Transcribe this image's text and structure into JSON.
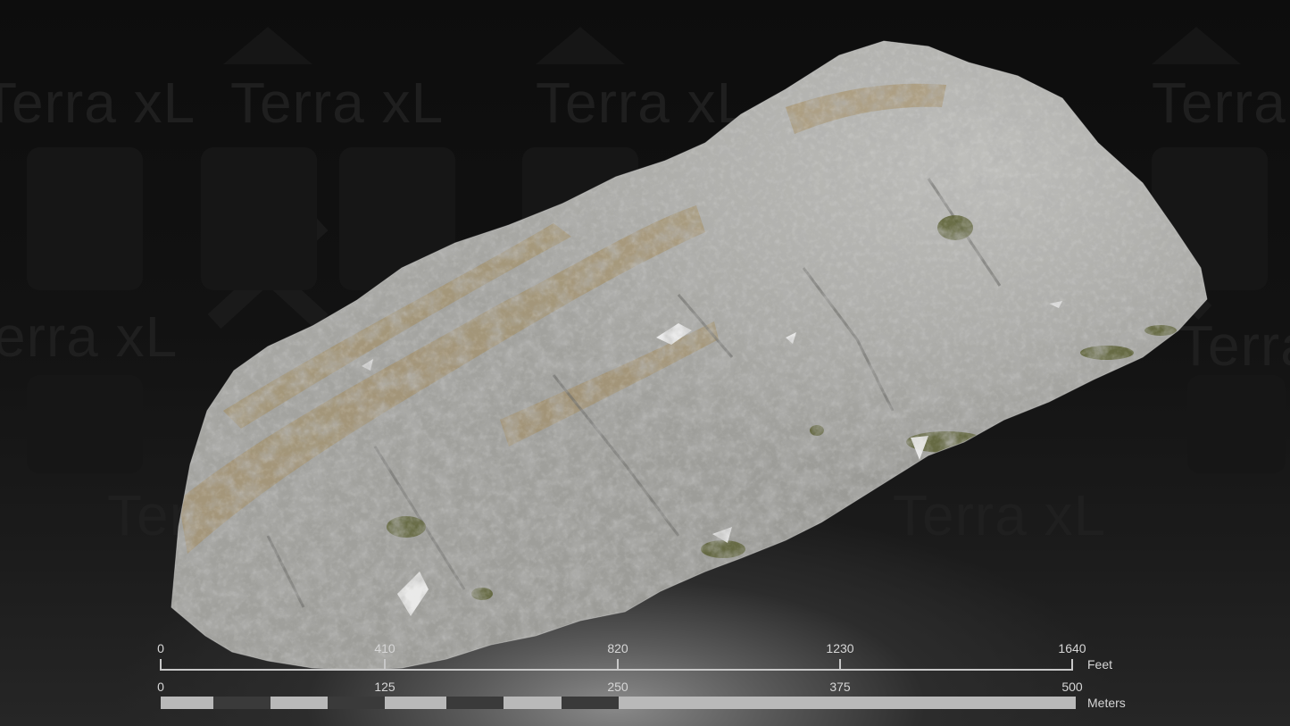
{
  "watermark": {
    "brand_text": "Terra xL"
  },
  "terrain": {
    "description_icon": "terrain-model-icon"
  },
  "scale_bar": {
    "feet": {
      "ticks": [
        "0",
        "410",
        "820",
        "1230",
        "1640"
      ],
      "unit": "Feet"
    },
    "meters": {
      "ticks": [
        "0",
        "125",
        "250",
        "375",
        "500"
      ],
      "unit": "Meters"
    },
    "colors": {
      "light": "#b9b9b9",
      "dark": "#3a3a3a",
      "line": "#c8c8c8"
    }
  }
}
